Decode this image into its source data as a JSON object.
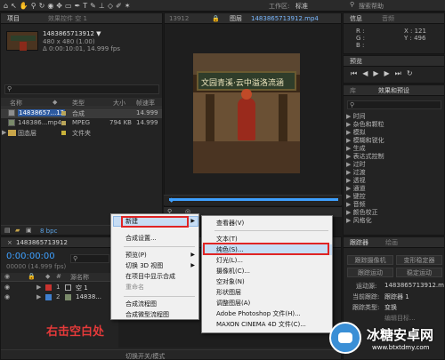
{
  "toolbar": {
    "workspace_label": "工作区:",
    "workspace_value": "标准",
    "search_placeholder": "搜索帮助"
  },
  "project_panel": {
    "tab_label": "项目",
    "effect_tab": "效果控件 空 1",
    "footage_name": "1483865713912 ▼",
    "footage_size": "480 x 480 (1.00)",
    "footage_time": "Δ 0:00:10:01, 14.999 fps",
    "columns": {
      "name": "名称",
      "type": "类型",
      "size": "大小",
      "fps": "帧速率"
    },
    "rows": [
      {
        "name": "14838657...12",
        "type": "合成",
        "size": "",
        "fps": "14.999"
      },
      {
        "name": "148386...mp4",
        "type": "MPEG",
        "size": "794 KB",
        "fps": "14.999"
      },
      {
        "name": "固态层",
        "type": "文件夹",
        "size": "",
        "fps": ""
      }
    ],
    "bpc": "8 bpc"
  },
  "composition_panel": {
    "tab_label": "1483865713912.mp4",
    "prev_tab": "13912",
    "layer_tab": "图层",
    "image_text": "文园青溪·云中溢洛流涵"
  },
  "info_panel": {
    "tab_info": "信息",
    "tab_audio": "音频",
    "r": "R :",
    "g": "G :",
    "b": "B :",
    "a": "A : 0",
    "x": "X : 121",
    "y": "Y : 496"
  },
  "preview_panel": {
    "tab": "预览"
  },
  "effects_panel": {
    "tab_lib": "库",
    "tab_effects": "效果和预设",
    "categories": [
      "时间",
      "杂色和颗粒",
      "模拟",
      "模糊和锐化",
      "生成",
      "表达式控制",
      "过时",
      "过渡",
      "透视",
      "通道",
      "键控",
      "音频",
      "颜色校正",
      "风格化"
    ]
  },
  "tracker_panel": {
    "tab": "跟踪器",
    "tab2": "绘画",
    "buttons": [
      "跟踪摄像机",
      "变形稳定器",
      "跟踪运动",
      "稳定运动"
    ],
    "source_label": "运动源:",
    "source_value": "1483865713912.m...",
    "current_label": "当前跟踪:",
    "current_value": "跟踪器 1",
    "type_label": "跟踪类型:",
    "type_value": "变换",
    "extra": "编辑目标..."
  },
  "timeline_panel": {
    "tab_label": "1483865713912",
    "timecode": "0:00:00:00",
    "fps": "00000 (14.999 fps)",
    "source_col": "源名称",
    "layers": [
      {
        "index": "1",
        "name": "空 1",
        "color": "#c8332f"
      },
      {
        "index": "2",
        "name": "14838...",
        "color": "#3f7fce"
      }
    ],
    "footer": "切换开关/模式"
  },
  "context_menu": {
    "items": [
      {
        "label": "新建",
        "arrow": "▶"
      },
      {
        "label": "合成设置..."
      },
      {
        "label": "预览(P)",
        "arrow": "▶"
      },
      {
        "label": "切换 3D 视图",
        "arrow": "▶"
      },
      {
        "label": "在项目中显示合成"
      },
      {
        "label": "重命名"
      },
      {
        "label": "合成流程图"
      },
      {
        "label": "合成微型流程图"
      }
    ]
  },
  "submenu": {
    "items": [
      {
        "label": "查看器(V)"
      },
      {
        "label": "文本(T)"
      },
      {
        "label": "纯色(S)..."
      },
      {
        "label": "灯光(L)..."
      },
      {
        "label": "摄像机(C)..."
      },
      {
        "label": "空对象(N)"
      },
      {
        "label": "形状图层"
      },
      {
        "label": "调整图层(A)"
      },
      {
        "label": "Adobe Photoshop 文件(H)..."
      },
      {
        "label": "MAXON CINEMA 4D 文件(C)..."
      }
    ]
  },
  "annotation": {
    "text": "右击空白处",
    "color": "#e53a3a"
  },
  "watermark": {
    "brand": "冰糖安卓网",
    "url": "www.btxtdmy.com"
  },
  "colors": {
    "accent": "#3ea0ff",
    "highlight_box": "#e02424"
  }
}
